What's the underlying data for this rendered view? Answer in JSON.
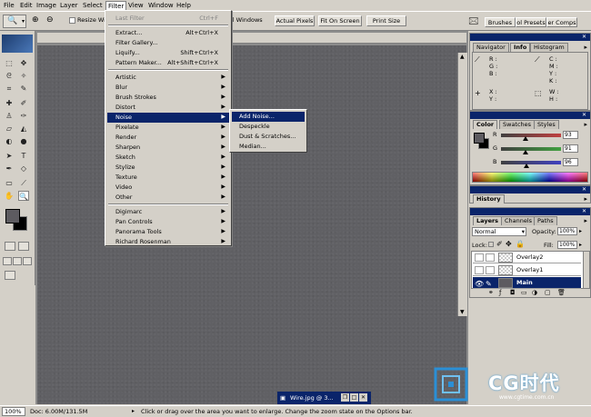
{
  "menubar": {
    "items": [
      "File",
      "Edit",
      "Image",
      "Layer",
      "Select",
      "Filter",
      "View",
      "Window",
      "Help"
    ],
    "active": "Filter"
  },
  "options": {
    "resize_label": "Resize Win",
    "fit_all_label": "ll Windows",
    "actual_pixels": "Actual Pixels",
    "fit_on_screen": "Fit On Screen",
    "print_size": "Print Size"
  },
  "palette_well": {
    "brushes": "Brushes",
    "tool_presets": "ol Presets",
    "layer_comps": "er Comps"
  },
  "filter_menu": {
    "last_filter": {
      "label": "Last Filter",
      "shortcut": "Ctrl+F"
    },
    "group1": [
      {
        "label": "Extract...",
        "shortcut": "Alt+Ctrl+X"
      },
      {
        "label": "Filter Gallery...",
        "shortcut": ""
      },
      {
        "label": "Liquify...",
        "shortcut": "Shift+Ctrl+X"
      },
      {
        "label": "Pattern Maker...",
        "shortcut": "Alt+Shift+Ctrl+X"
      }
    ],
    "group2": [
      "Artistic",
      "Blur",
      "Brush Strokes",
      "Distort",
      "Noise",
      "Pixelate",
      "Render",
      "Sharpen",
      "Sketch",
      "Stylize",
      "Texture",
      "Video",
      "Other"
    ],
    "highlighted": "Noise",
    "group3": [
      "Digimarc",
      "Pan Controls",
      "Panorama Tools",
      "Richard Rosenman"
    ]
  },
  "noise_submenu": [
    "Add Noise...",
    "Despeckle",
    "Dust & Scratches...",
    "Median..."
  ],
  "navigator": {
    "tabs": [
      "Navigator",
      "Info",
      "Histogram"
    ],
    "active_tab": "Info",
    "left_labels": [
      "R :",
      "G :",
      "B :"
    ],
    "right_labels": [
      "C :",
      "M :",
      "Y :",
      "K :"
    ],
    "xy": [
      "X :",
      "Y :"
    ],
    "wh": [
      "W :",
      "H :"
    ]
  },
  "color_panel": {
    "tabs": [
      "Color",
      "Swatches",
      "Styles"
    ],
    "active_tab": "Color",
    "channels": [
      {
        "label": "R",
        "value": "93",
        "color": "#c04040"
      },
      {
        "label": "G",
        "value": "91",
        "color": "#40a040"
      },
      {
        "label": "B",
        "value": "96",
        "color": "#4040c0"
      }
    ]
  },
  "history_panel": {
    "title": "History"
  },
  "layers_panel": {
    "tabs": [
      "Layers",
      "Channels",
      "Paths"
    ],
    "active_tab": "Layers",
    "blend_mode": "Normal",
    "opacity_label": "Opacity:",
    "opacity_value": "100%",
    "lock_label": "Lock:",
    "fill_label": "Fill:",
    "fill_value": "100%",
    "layers": [
      {
        "name": "Overlay2",
        "selected": false
      },
      {
        "name": "Overlay1",
        "selected": false
      },
      {
        "name": "Main",
        "selected": true
      }
    ]
  },
  "status": {
    "zoom": "100%",
    "doc": "Doc: 6.00M/131.5M",
    "hint": "Click or drag over the area you want to enlarge. Change the zoom state on the Options bar."
  },
  "minimized_doc": {
    "title": "Wire.jpg @ 3..."
  },
  "watermark": {
    "brand": "CG时代",
    "url": "www.cgtime.com.cn"
  }
}
